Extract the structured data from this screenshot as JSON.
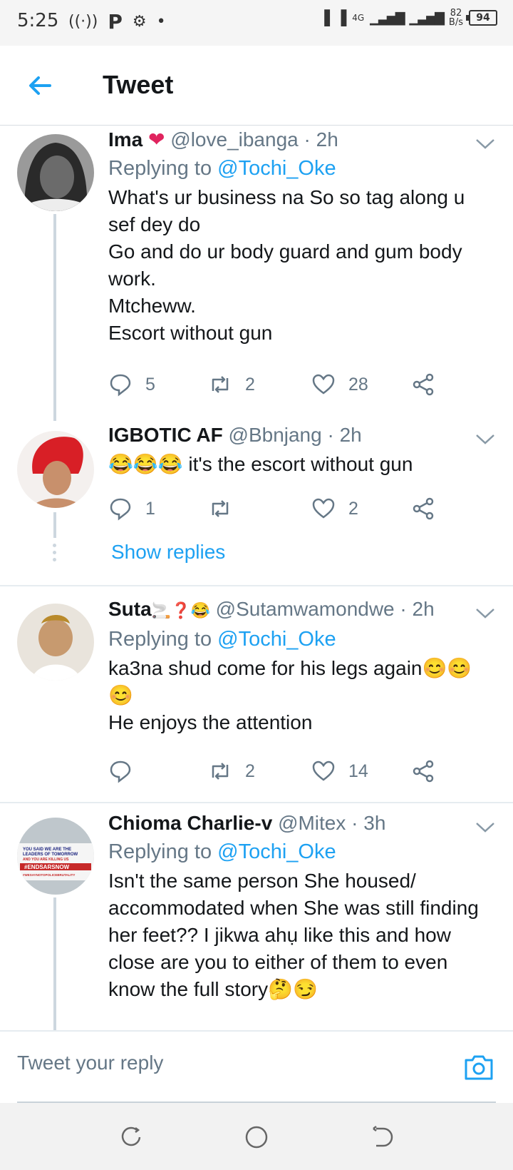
{
  "status_bar": {
    "time": "5:25",
    "network": "4G",
    "speed_value": "82",
    "speed_unit": "B/s",
    "battery": "94"
  },
  "header": {
    "title": "Tweet"
  },
  "tweets": [
    {
      "name": "Ima",
      "name_emoji": "❤️",
      "handle": "@love_ibanga",
      "time": "· 2h",
      "replying_label": "Replying to",
      "replying_to": "@Tochi_Oke",
      "text": "What's ur business na So  so tag along u sef dey do\nGo and do ur body guard and gum body work.\nMtcheww.\nEscort without gun",
      "replies": "5",
      "retweets": "2",
      "likes": "28"
    },
    {
      "name": "IGBOTIC AF",
      "handle": "@Bbnjang",
      "time": "· 2h",
      "text": "😂😂😂 it's the escort without gun",
      "replies": "1",
      "retweets": "",
      "likes": "2",
      "show_replies": "Show replies"
    },
    {
      "name": "Suta",
      "name_emoji": "🚬❓😂",
      "handle": "@Sutamwamondwe",
      "time": "· 2h",
      "replying_label": "Replying to",
      "replying_to": "@Tochi_Oke",
      "text": "ka3na shud come for his legs again😊😊😊\nHe enjoys the attention",
      "replies": "",
      "retweets": "2",
      "likes": "14"
    },
    {
      "name": "Chioma Charlie-v",
      "handle": "@Mitex",
      "time": "· 3h",
      "replying_label": "Replying to",
      "replying_to": "@Tochi_Oke",
      "text": "Isn't the same person She housed/ accommodated when She was still finding her feet?? I jikwa ahụ like this and how close are you to either of them to even know the full story🤔😏",
      "avatar_banner": [
        "YOU SAID WE ARE THE",
        "LEADERS OF TOMORROW",
        "AND YOU ARE KILLING US",
        "#ENDSARSNOW",
        "#WESAYNOTOPOLICEBRUTALITY"
      ]
    }
  ],
  "reply_bar": {
    "placeholder": "Tweet your reply"
  },
  "colors": {
    "accent": "#1da1f2",
    "secondary_text": "#657786",
    "heart": "#e0245e"
  }
}
